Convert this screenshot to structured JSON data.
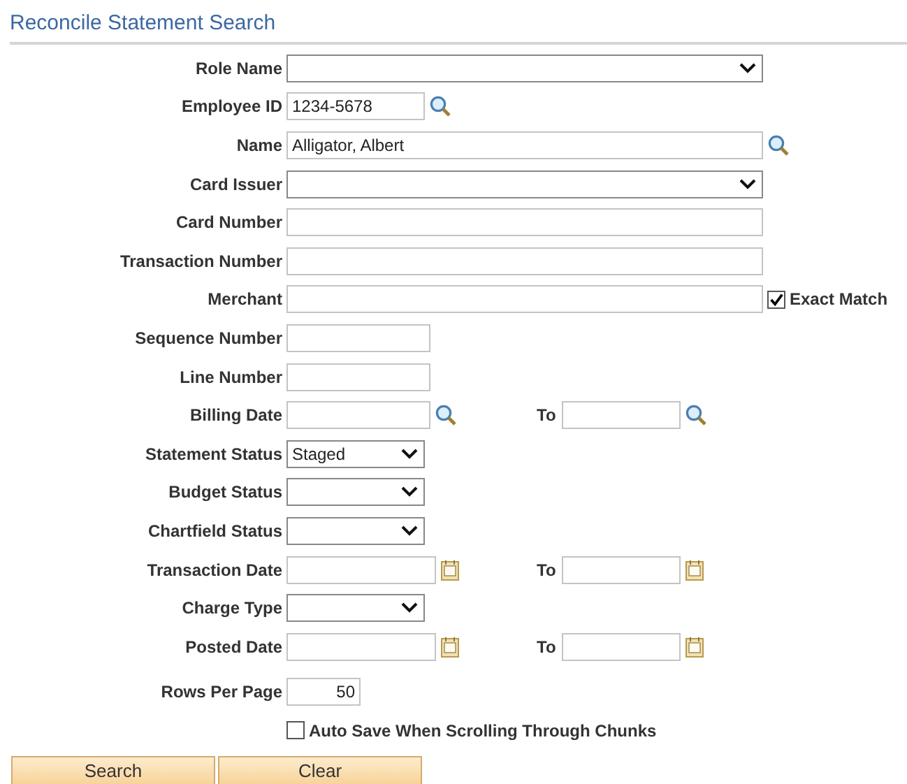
{
  "title": "Reconcile Statement Search",
  "fields": [
    {
      "label": "Role Name",
      "kind": "wide-select"
    },
    {
      "label": "Employee ID",
      "kind": "lookup",
      "value": "1234-5678"
    },
    {
      "label": "Name",
      "kind": "wide-lookup",
      "value": "Alligator, Albert"
    },
    {
      "label": "Card Issuer",
      "kind": "wide-select"
    },
    {
      "label": "Card Number",
      "kind": "wide-text"
    },
    {
      "label": "Transaction Number",
      "kind": "wide-text"
    },
    {
      "label": "Merchant",
      "kind": "wide-text",
      "exact_match": {
        "label": "Exact Match",
        "checked": true
      }
    },
    {
      "label": "Sequence Number",
      "kind": "short-text"
    },
    {
      "label": "Line Number",
      "kind": "short-text"
    },
    {
      "label": "Billing Date",
      "kind": "lookup-range",
      "to_label": "To"
    },
    {
      "label": "Statement Status",
      "kind": "short-select",
      "value": "Staged"
    },
    {
      "label": "Budget Status",
      "kind": "short-select"
    },
    {
      "label": "Chartfield Status",
      "kind": "short-select"
    },
    {
      "label": "Transaction Date",
      "kind": "date-range",
      "to_label": "To"
    },
    {
      "label": "Charge Type",
      "kind": "short-select"
    },
    {
      "label": "Posted Date",
      "kind": "date-range",
      "to_label": "To"
    },
    {
      "label": "Rows Per Page",
      "kind": "number",
      "value": "50"
    }
  ],
  "auto_save": {
    "label": "Auto Save When Scrolling Through Chunks",
    "checked": false
  },
  "buttons": [
    "Search",
    "Clear"
  ]
}
